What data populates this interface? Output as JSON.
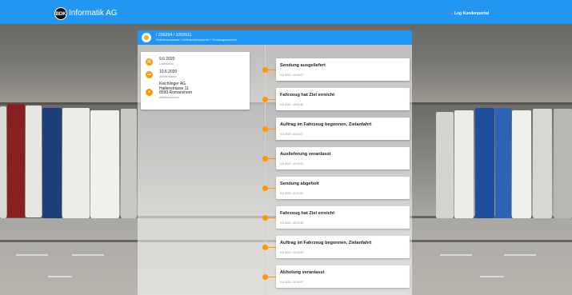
{
  "header": {
    "logo_text": "BDK",
    "brand": "Informatik AG",
    "portal_link": "Log Kundenportal"
  },
  "shipment": {
    "numbers": "/ 200264 / 1059911",
    "numbers_caption": "Referenznummer / Lieferscheinnummer / Sendungsnummer"
  },
  "info": [
    {
      "icon": "calendar-icon",
      "value": "9.6.2020",
      "caption": "Ladedatum"
    },
    {
      "icon": "truck-icon",
      "value": "10.6.2020",
      "caption": "Ablieferdatum"
    },
    {
      "icon": "location-icon",
      "lines": [
        "Keichlinger AG",
        "Hallenstrasse 11",
        "8590 Romanshorn"
      ],
      "caption": "Ablieferadresse"
    }
  ],
  "events": [
    {
      "title": "Sendung ausgeliefert",
      "time": "9.6.2020, 16:04:07"
    },
    {
      "title": "Fahrzeug hat Ziel erreicht",
      "time": "9.6.2020, 15:54:48"
    },
    {
      "title": "Auftrag im Fahrzeug begonnen. Zielanfahrt",
      "time": "9.6.2020, 16:04:07"
    },
    {
      "title": "Auslieferung veranlasst",
      "time": "9.6.2020, 16:29:00"
    },
    {
      "title": "Sendung abgeholt",
      "time": "9.6.2020, 16:22:00"
    },
    {
      "title": "Fahrzeug hat Ziel erreicht",
      "time": "9.6.2020, 15:23:36"
    },
    {
      "title": "Auftrag im Fahrzeug begonnen. Zielanfahrt",
      "time": "9.6.2020, 15:23:09"
    },
    {
      "title": "Abholung veranlasst",
      "time": "9.6.2020, 15:18:57"
    }
  ],
  "colors": {
    "primary": "#2196f3",
    "accent": "#ff9800"
  }
}
